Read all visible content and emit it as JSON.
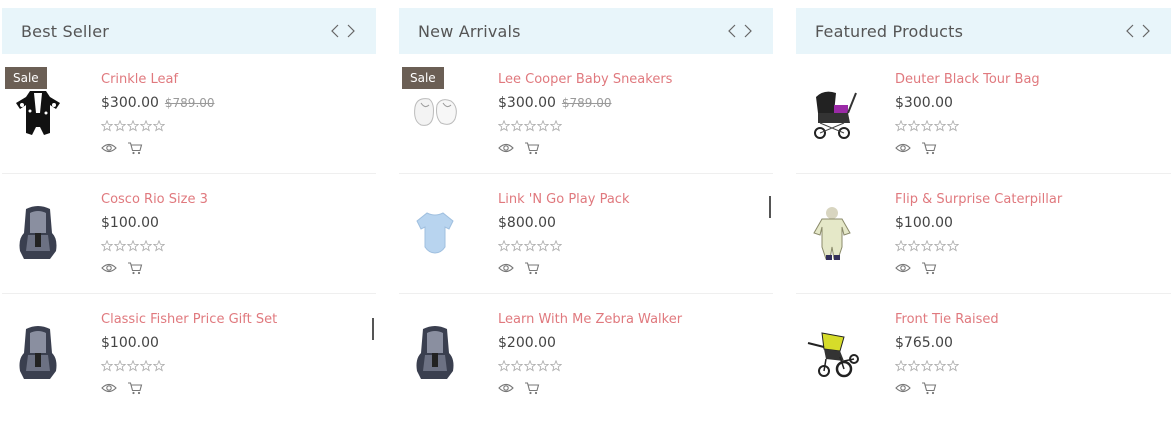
{
  "colors": {
    "header_bg": "#e8f5fa",
    "product_name": "#e0797e",
    "sale_badge": "#6b5f55"
  },
  "columns": [
    {
      "title": "Best Seller",
      "products": [
        {
          "name": "Crinkle Leaf",
          "price": "$300.00",
          "old_price": "$789.00",
          "sale": "Sale",
          "image_icon": "onesie-icon"
        },
        {
          "name": "Cosco Rio Size 3",
          "price": "$100.00",
          "old_price": "",
          "sale": "",
          "image_icon": "car-seat-icon"
        },
        {
          "name": "Classic Fisher Price Gift Set",
          "price": "$100.00",
          "old_price": "",
          "sale": "",
          "image_icon": "car-seat-icon"
        }
      ]
    },
    {
      "title": "New Arrivals",
      "products": [
        {
          "name": "Lee Cooper Baby Sneakers",
          "price": "$300.00",
          "old_price": "$789.00",
          "sale": "Sale",
          "image_icon": "shoes-icon"
        },
        {
          "name": "Link 'N Go Play Pack",
          "price": "$800.00",
          "old_price": "",
          "sale": "",
          "image_icon": "bodysuit-icon"
        },
        {
          "name": "Learn With Me Zebra Walker",
          "price": "$200.00",
          "old_price": "",
          "sale": "",
          "image_icon": "car-seat-icon"
        }
      ]
    },
    {
      "title": "Featured Products",
      "products": [
        {
          "name": "Deuter Black Tour Bag",
          "price": "$300.00",
          "old_price": "",
          "sale": "",
          "image_icon": "stroller-icon"
        },
        {
          "name": "Flip & Surprise Caterpillar",
          "price": "$100.00",
          "old_price": "",
          "sale": "",
          "image_icon": "snowsuit-icon"
        },
        {
          "name": "Front Tie Raised",
          "price": "$765.00",
          "old_price": "",
          "sale": "",
          "image_icon": "jogger-stroller-icon"
        }
      ]
    }
  ]
}
